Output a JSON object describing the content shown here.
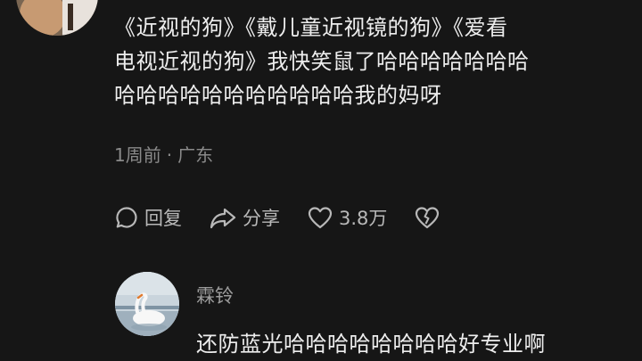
{
  "comment": {
    "lines": [
      "《近视的狗》《戴儿童近视镜的狗》《爱看",
      "电视近视的狗》我快笑鼠了哈哈哈哈哈哈哈",
      "哈哈哈哈哈哈哈哈哈哈哈我的妈呀"
    ],
    "time": "1周前",
    "separator": "·",
    "location": "广东",
    "reply_label": "回复",
    "share_label": "分享",
    "like_count": "3.8万",
    "icons": {
      "reply": "comment-bubble-icon",
      "share": "share-arrow-icon",
      "like": "heart-icon",
      "dislike": "broken-heart-icon"
    }
  },
  "reply": {
    "username": "霖铃",
    "text": "还防蓝光哈哈哈哈哈哈哈哈好专业啊"
  },
  "colors": {
    "background": "#161616",
    "text": "#ededed",
    "meta": "#8a8a8a",
    "action": "#b8b8b8"
  }
}
